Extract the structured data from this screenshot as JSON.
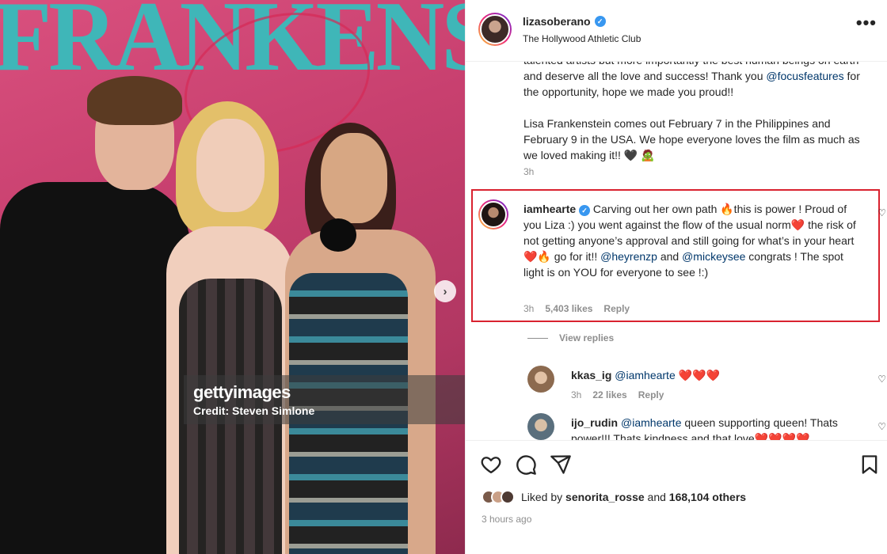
{
  "photo": {
    "banner_text": "FRANKENSTEIN",
    "watermark_logo": "gettyimages",
    "watermark_credit": "Credit: Steven Simlone",
    "next_arrow": "›"
  },
  "post": {
    "username": "lizasoberano",
    "location": "The Hollywood Athletic Club",
    "more": "•••"
  },
  "caption": {
    "line1": "talented artists but more importantly the best human beings on earth and deserve all the love and success! Thank you ",
    "mention": "@focusfeatures",
    "line1_end": " for the opportunity, hope we made you proud!!",
    "para2": "Lisa Frankenstein comes out February 7 in the Philippines and February 9 in the USA. We hope everyone loves the film as much as we loved making it!! 🖤 🧟",
    "time": "3h"
  },
  "highlighted_comment": {
    "username": "iamhearte",
    "text_a": " Carving out her own path 🔥this is power ! Proud of you Liza :) you went against the flow of the usual norm❤️ the risk of not getting anyone’s approval and still going for what’s in your heart ❤️🔥 go for it!! ",
    "mention1": "@heyrenzp",
    "text_b": " and ",
    "mention2": "@mickeysee",
    "text_c": " congrats ! The spot light is on YOU for everyone to see !:)",
    "time": "3h",
    "likes": "5,403 likes",
    "reply": "Reply"
  },
  "view_replies": "View replies",
  "replies": [
    {
      "username": "kkas_ig",
      "mention": "@iamhearte",
      "text": " ❤️❤️❤️",
      "time": "3h",
      "likes": "22 likes",
      "reply": "Reply"
    },
    {
      "username": "ijo_rudin",
      "mention": "@iamhearte",
      "text": " queen supporting queen! Thats power!!! Thats kindness and that love❤️❤️❤️❤️"
    }
  ],
  "likes": {
    "prefix": "Liked by ",
    "user": "senorita_rosse",
    "middle": " and ",
    "count": "168,104 others"
  },
  "posted_ago": "3 hours ago",
  "icons": [
    "heart-icon",
    "comment-icon",
    "share-icon",
    "bookmark-icon",
    "verified-badge-icon"
  ],
  "colors": {
    "highlight_border": "#d9222f",
    "mention": "#00376b",
    "verified": "#3897f0",
    "banner": "#3fb6b8",
    "backdrop": "#c8406f"
  }
}
